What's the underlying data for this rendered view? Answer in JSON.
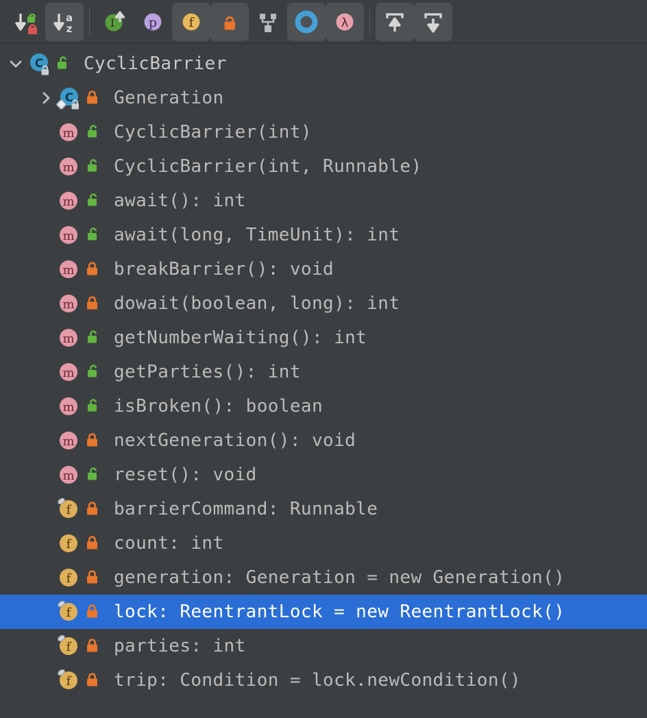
{
  "toolbar": {
    "buttons": [
      {
        "name": "sort-by-visibility-button",
        "icon": "sort-visibility-icon",
        "label": "Sort by Visibility",
        "toggled": false,
        "sep_after": false
      },
      {
        "name": "sort-alphabetically-button",
        "icon": "sort-alphabetical-icon",
        "label": "Sort Alphabetically",
        "toggled": true,
        "sep_after": true
      },
      {
        "name": "show-inherited-button",
        "icon": "inherited-members-icon",
        "label": "Show Inherited Members",
        "toggled": false,
        "sep_after": false
      },
      {
        "name": "show-properties-button",
        "icon": "properties-icon",
        "label": "Show Properties",
        "toggled": false,
        "sep_after": false
      },
      {
        "name": "show-fields-button",
        "icon": "fields-icon",
        "label": "Show Fields",
        "toggled": true,
        "sep_after": false
      },
      {
        "name": "show-non-public-button",
        "icon": "non-public-icon",
        "label": "Show Non-Public",
        "toggled": true,
        "sep_after": false
      },
      {
        "name": "show-hierarchy-button",
        "icon": "hierarchy-icon",
        "label": "Show Class Hierarchy",
        "toggled": false,
        "sep_after": false
      },
      {
        "name": "show-anonymous-classes-button",
        "icon": "anonymous-class-icon",
        "label": "Show Anonymous Classes",
        "toggled": true,
        "sep_after": false
      },
      {
        "name": "show-lambdas-button",
        "icon": "lambda-icon",
        "label": "Show Lambdas",
        "toggled": true,
        "sep_after": true
      },
      {
        "name": "expand-all-button",
        "icon": "expand-all-icon",
        "label": "Expand All",
        "toggled": true,
        "sep_after": false
      },
      {
        "name": "collapse-all-button",
        "icon": "collapse-all-icon",
        "label": "Collapse All",
        "toggled": true,
        "sep_after": false
      }
    ]
  },
  "tree": {
    "rows": [
      {
        "text": "CyclicBarrier",
        "kind": "class",
        "visibility": "public",
        "twisty": "expanded",
        "indent": 0,
        "selected": false,
        "final": false,
        "static_inner": false
      },
      {
        "text": "Generation",
        "kind": "class",
        "visibility": "private",
        "twisty": "collapsed",
        "indent": 1,
        "selected": false,
        "final": false,
        "static_inner": true
      },
      {
        "text": "CyclicBarrier(int)",
        "kind": "method",
        "visibility": "public",
        "twisty": "none",
        "indent": 1,
        "selected": false,
        "final": false,
        "static_inner": false
      },
      {
        "text": "CyclicBarrier(int, Runnable)",
        "kind": "method",
        "visibility": "public",
        "twisty": "none",
        "indent": 1,
        "selected": false,
        "final": false,
        "static_inner": false
      },
      {
        "text": "await(): int",
        "kind": "method",
        "visibility": "public",
        "twisty": "none",
        "indent": 1,
        "selected": false,
        "final": false,
        "static_inner": false
      },
      {
        "text": "await(long, TimeUnit): int",
        "kind": "method",
        "visibility": "public",
        "twisty": "none",
        "indent": 1,
        "selected": false,
        "final": false,
        "static_inner": false
      },
      {
        "text": "breakBarrier(): void",
        "kind": "method",
        "visibility": "private",
        "twisty": "none",
        "indent": 1,
        "selected": false,
        "final": false,
        "static_inner": false
      },
      {
        "text": "dowait(boolean, long): int",
        "kind": "method",
        "visibility": "private",
        "twisty": "none",
        "indent": 1,
        "selected": false,
        "final": false,
        "static_inner": false
      },
      {
        "text": "getNumberWaiting(): int",
        "kind": "method",
        "visibility": "public",
        "twisty": "none",
        "indent": 1,
        "selected": false,
        "final": false,
        "static_inner": false
      },
      {
        "text": "getParties(): int",
        "kind": "method",
        "visibility": "public",
        "twisty": "none",
        "indent": 1,
        "selected": false,
        "final": false,
        "static_inner": false
      },
      {
        "text": "isBroken(): boolean",
        "kind": "method",
        "visibility": "public",
        "twisty": "none",
        "indent": 1,
        "selected": false,
        "final": false,
        "static_inner": false
      },
      {
        "text": "nextGeneration(): void",
        "kind": "method",
        "visibility": "private",
        "twisty": "none",
        "indent": 1,
        "selected": false,
        "final": false,
        "static_inner": false
      },
      {
        "text": "reset(): void",
        "kind": "method",
        "visibility": "public",
        "twisty": "none",
        "indent": 1,
        "selected": false,
        "final": false,
        "static_inner": false
      },
      {
        "text": "barrierCommand: Runnable",
        "kind": "field",
        "visibility": "private",
        "twisty": "none",
        "indent": 1,
        "selected": false,
        "final": true,
        "static_inner": false
      },
      {
        "text": "count: int",
        "kind": "field",
        "visibility": "private",
        "twisty": "none",
        "indent": 1,
        "selected": false,
        "final": false,
        "static_inner": false
      },
      {
        "text": "generation: Generation = new Generation()",
        "kind": "field",
        "visibility": "private",
        "twisty": "none",
        "indent": 1,
        "selected": false,
        "final": false,
        "static_inner": false
      },
      {
        "text": "lock: ReentrantLock = new ReentrantLock()",
        "kind": "field",
        "visibility": "private",
        "twisty": "none",
        "indent": 1,
        "selected": true,
        "final": true,
        "static_inner": false
      },
      {
        "text": "parties: int",
        "kind": "field",
        "visibility": "private",
        "twisty": "none",
        "indent": 1,
        "selected": false,
        "final": true,
        "static_inner": false
      },
      {
        "text": "trip: Condition = lock.newCondition()",
        "kind": "field",
        "visibility": "private",
        "twisty": "none",
        "indent": 1,
        "selected": false,
        "final": true,
        "static_inner": false
      }
    ]
  },
  "colors": {
    "background": "#3c3f41",
    "selection": "#2a6dd4",
    "text": "#bbbbbb",
    "selected_text": "#ffffff",
    "class_icon": "#3399cc",
    "method_icon": "#e8a0ad",
    "field_icon": "#e8b martin",
    "public_lock": "#62b543",
    "private_lock": "#e8762c"
  }
}
